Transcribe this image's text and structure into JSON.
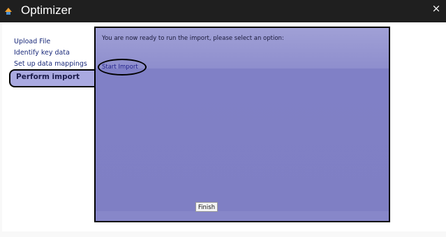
{
  "window": {
    "title": "Optimizer",
    "close_symbol": "×"
  },
  "steps": {
    "items": [
      {
        "label": "Upload File"
      },
      {
        "label": "Identify key data"
      },
      {
        "label": "Set up data mappings"
      }
    ],
    "active_label": "Perform import"
  },
  "panel": {
    "prompt": "You are now ready to run the import, please select an option:",
    "start_import_label": "Start Import",
    "finish_label": "Finish"
  },
  "colors": {
    "titlebar": "#1f1f1f",
    "panel_bg": "#7f7fc4",
    "active_step_bg": "#a9a9e0",
    "link": "#1a2a7a"
  }
}
